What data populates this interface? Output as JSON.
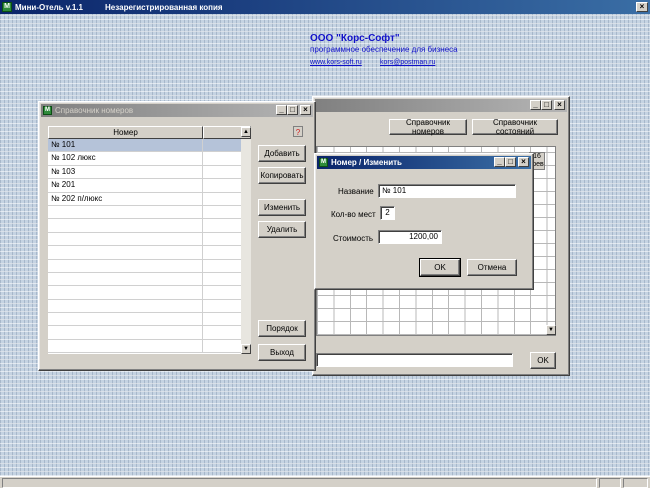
{
  "app": {
    "title": "Мини-Отель v.1.1",
    "subtitle": "Незарегистрированная копия",
    "icon_glyph": "М",
    "close_glyph": "×"
  },
  "company": {
    "name": "ООО \"Корс-Софт\"",
    "tagline": "программное обеспечение для бизнеса",
    "website": "www.kors-soft.ru",
    "email": "kors@postman.ru"
  },
  "background_window": {
    "rooms_button": "Справочник номеров",
    "states_button": "Справочник состояний",
    "column_header_top": "16",
    "column_header_bottom": "фев",
    "ok_button": "OK",
    "scroll_down_glyph": "▼"
  },
  "rooms_window": {
    "title": "Справочник номеров",
    "column_header": "Номер",
    "help_glyph": "?",
    "rows": [
      {
        "name": "№ 101",
        "selected": true
      },
      {
        "name": "№ 102 люкс",
        "selected": false
      },
      {
        "name": "№ 103",
        "selected": false
      },
      {
        "name": "№ 201",
        "selected": false
      },
      {
        "name": "№ 202 п/люкс",
        "selected": false
      }
    ],
    "buttons": {
      "add": "Добавить",
      "copy": "Копировать",
      "edit": "Изменить",
      "delete": "Удалить",
      "order": "Порядок",
      "exit": "Выход"
    },
    "scroll_up_glyph": "▲",
    "scroll_down_glyph": "▼"
  },
  "edit_dialog": {
    "title": "Номер / Изменить",
    "labels": {
      "name": "Название",
      "seats": "Кол-во мест",
      "price": "Стоимость"
    },
    "values": {
      "name": "№ 101",
      "seats": "2",
      "price": "1200,00"
    },
    "ok_button": "OK",
    "cancel_button": "Отмена"
  },
  "window_controls": {
    "minimize": "_",
    "maximize": "□",
    "close": "×"
  },
  "colors": {
    "title_active": "#0a246a",
    "title_inactive": "#808080",
    "link": "#1010c8",
    "selection": "#b5c3d9",
    "face": "#d4d0c8"
  }
}
